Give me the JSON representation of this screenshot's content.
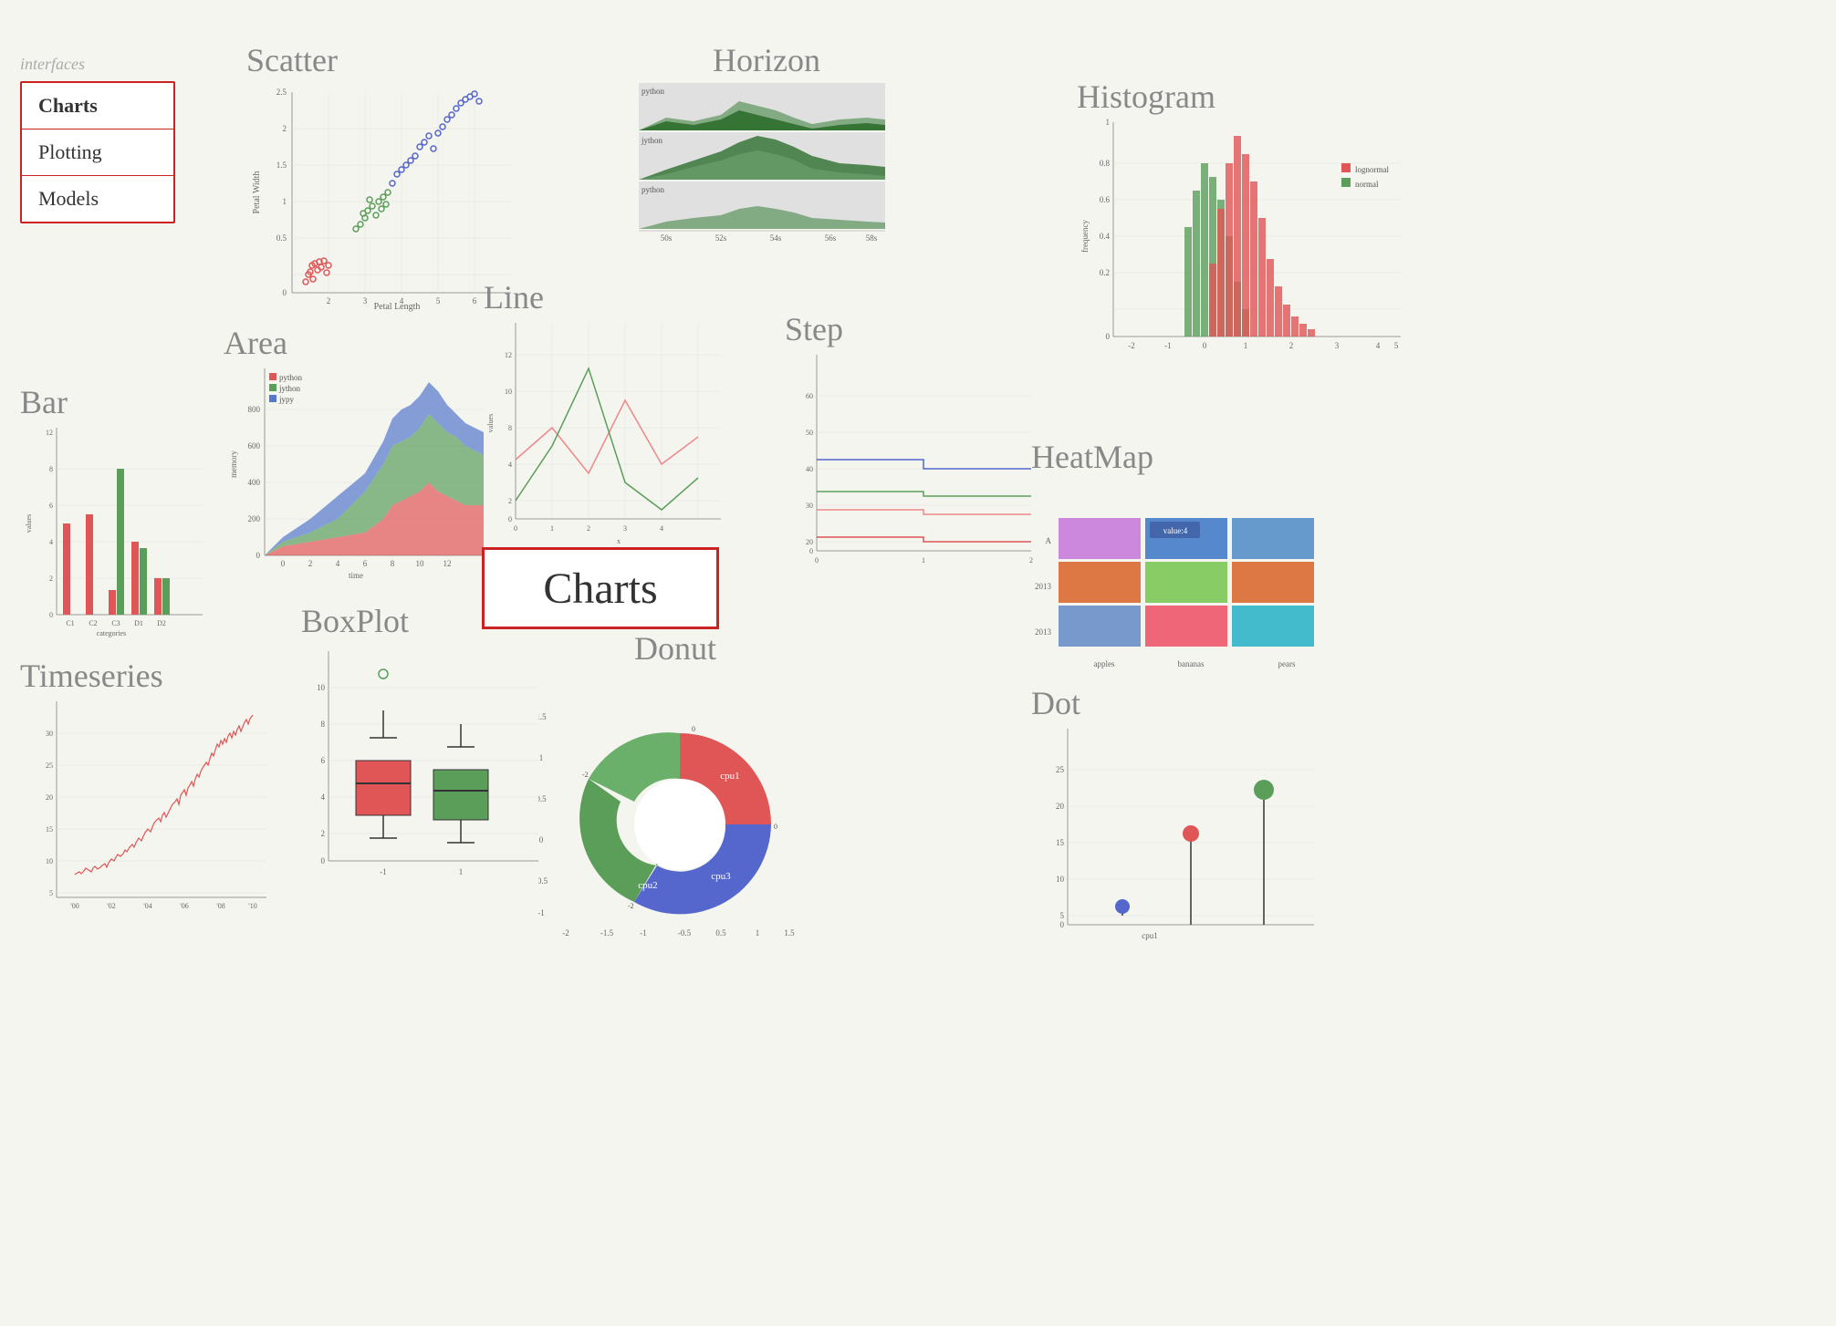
{
  "sidebar": {
    "label": "interfaces",
    "items": [
      {
        "label": "Charts",
        "active": true
      },
      {
        "label": "Plotting",
        "active": false
      },
      {
        "label": "Models",
        "active": false
      }
    ]
  },
  "charts": {
    "center_label": "Charts",
    "titles": {
      "scatter": "Scatter",
      "area": "Area",
      "bar": "Bar",
      "timeseries": "Timeseries",
      "boxplot": "BoxPlot",
      "horizon": "Horizon",
      "line": "Line",
      "step": "Step",
      "donut": "Donut",
      "histogram": "Histogram",
      "heatmap": "HeatMap",
      "dot": "Dot"
    }
  }
}
